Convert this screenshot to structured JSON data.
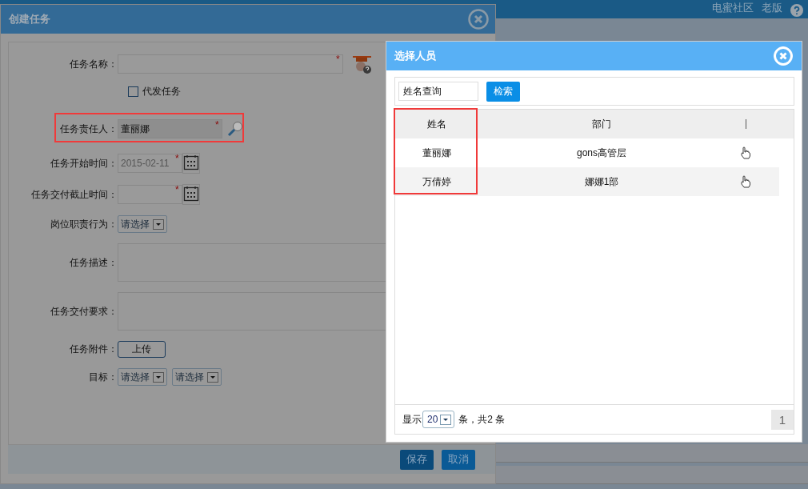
{
  "header_links": [
    "电蜜社区",
    "老版"
  ],
  "task_dialog": {
    "title": "创建任务",
    "fields": [
      {
        "kind": "text",
        "label": "任务名称：",
        "required_mark": "*"
      },
      {
        "kind": "checkbox",
        "label": "代发任务",
        "checked": false
      },
      {
        "kind": "person",
        "label": "任务责任人：",
        "value": "董丽娜",
        "required_mark": "*",
        "highlighted": true
      },
      {
        "kind": "date",
        "label": "任务开始时间：",
        "value": "2015-02-11",
        "required_mark": "*"
      },
      {
        "kind": "date",
        "label": "任务交付截止时间：",
        "required_mark": "*"
      },
      {
        "kind": "select",
        "label": "岗位职责行为：",
        "selects": [
          "请选择"
        ]
      },
      {
        "kind": "textarea",
        "label": "任务描述："
      },
      {
        "kind": "textarea",
        "label": "任务交付要求："
      },
      {
        "kind": "upload",
        "label": "任务附件：",
        "button": "上传"
      },
      {
        "kind": "select",
        "label": "目标：",
        "selects": [
          "请选择",
          "请选择"
        ]
      }
    ],
    "buttons": [
      "保存",
      "取消"
    ]
  },
  "person_dialog": {
    "title": "选择人员",
    "search": {
      "placeholder": "姓名查询"
    },
    "search_button": "检索",
    "columns": [
      {
        "label": "姓名",
        "highlighted": true
      },
      {
        "label": "部门",
        "highlighted": false
      }
    ],
    "rows": [
      {
        "name": "董丽娜",
        "department": "gons高管层"
      },
      {
        "name": "万倩婷",
        "department": "娜娜1部"
      }
    ],
    "footer": {
      "show": "显示",
      "page_size": "20",
      "total": "条，共2 条",
      "page": "1"
    }
  }
}
